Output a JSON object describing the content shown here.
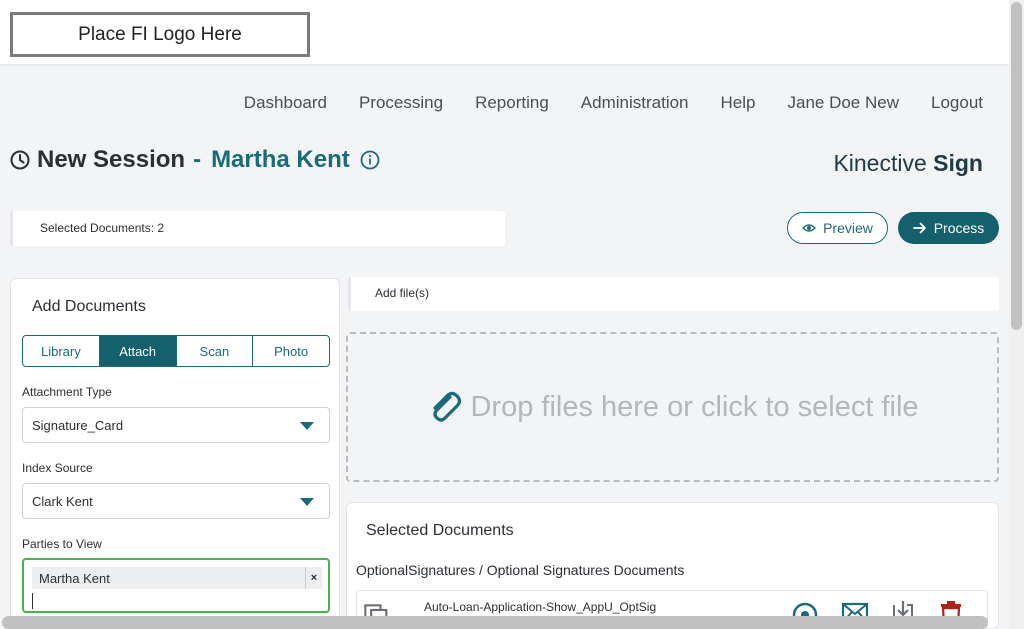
{
  "header": {
    "logo_text": "Place FI Logo Here"
  },
  "nav": {
    "items": [
      "Dashboard",
      "Processing",
      "Reporting",
      "Administration",
      "Help",
      "Jane Doe New",
      "Logout"
    ]
  },
  "session": {
    "title": "New Session",
    "dash": "-",
    "customer": "Martha Kent"
  },
  "brand": {
    "light": "Kinective",
    "bold": "Sign"
  },
  "selection": {
    "text": "Selected Documents: 2"
  },
  "actions": {
    "preview_label": "Preview",
    "process_label": "Process"
  },
  "add_documents": {
    "title": "Add Documents",
    "tabs": [
      {
        "label": "Library",
        "active": false
      },
      {
        "label": "Attach",
        "active": true
      },
      {
        "label": "Scan",
        "active": false
      },
      {
        "label": "Photo",
        "active": false
      }
    ],
    "attachment_type": {
      "label": "Attachment Type",
      "value": "Signature_Card"
    },
    "index_source": {
      "label": "Index Source",
      "value": "Clark Kent"
    },
    "parties": {
      "label": "Parties to View",
      "chips": [
        "Martha Kent"
      ],
      "remove_glyph": "×"
    }
  },
  "upload": {
    "add_files_label": "Add file(s)",
    "drop_text": "Drop files here or click to select file"
  },
  "selected_documents": {
    "title": "Selected Documents",
    "group": "OptionalSignatures / Optional Signatures Documents",
    "rows": [
      {
        "name": "Auto-Loan-Application-Show_AppU_OptSig"
      }
    ]
  },
  "colors": {
    "accent": "#1a6b77",
    "accent_dark": "#14606c",
    "delete": "#b0201a",
    "focus": "#4caf50"
  }
}
